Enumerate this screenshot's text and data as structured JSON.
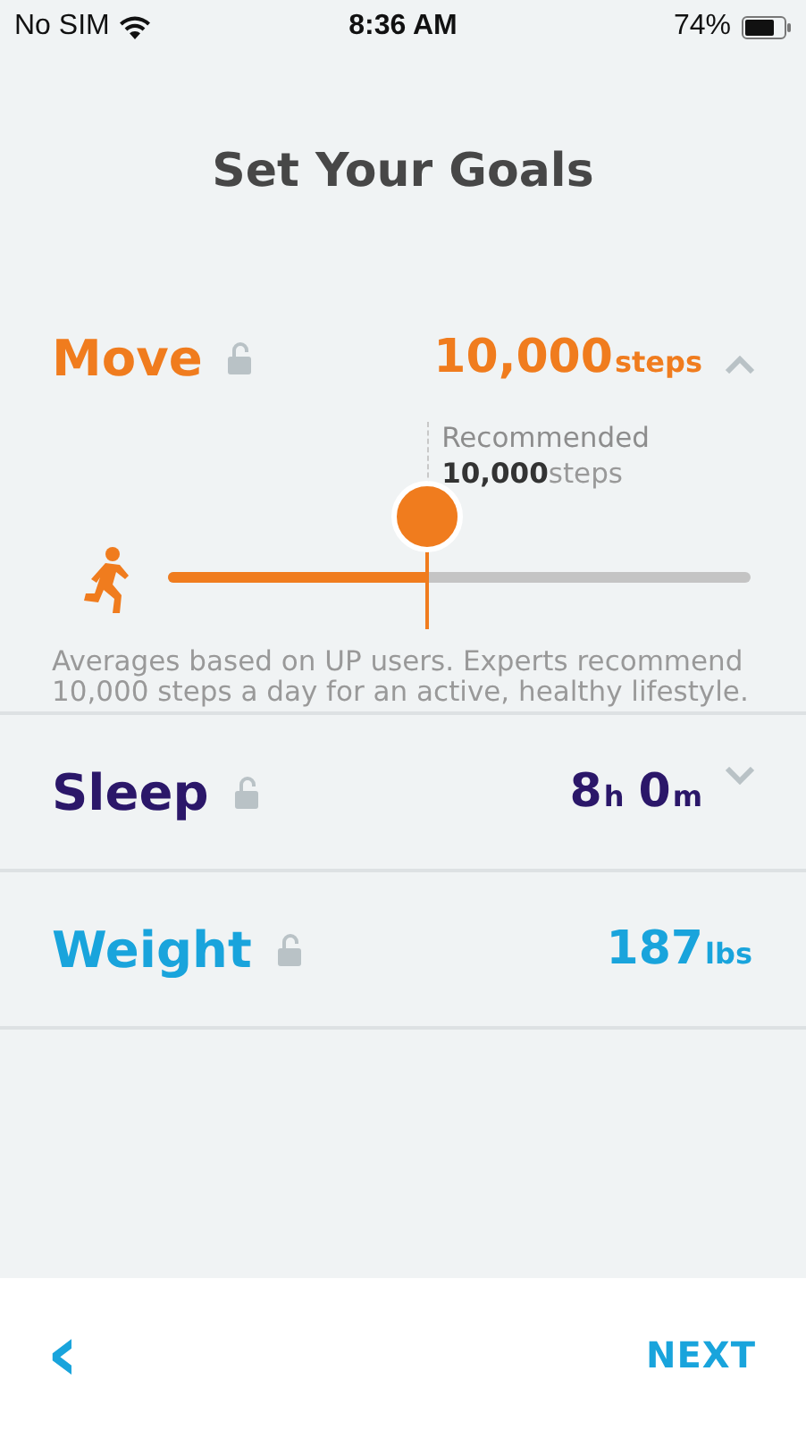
{
  "status_bar": {
    "carrier": "No SIM",
    "time": "8:36 AM",
    "battery": "74%"
  },
  "title": "Set Your Goals",
  "goals": [
    {
      "kind": "slider",
      "name": "Move",
      "color": "#f07c1e",
      "expanded": true,
      "value": [
        {
          "text": "10,000",
          "kind": "number"
        },
        {
          "text": "steps",
          "kind": "unit"
        }
      ],
      "slider": {
        "level": 0.445,
        "recommended_label": "Recommended",
        "recommended_value": [
          {
            "text": "10,000",
            "kind": "number"
          },
          {
            "text": "steps",
            "kind": "unit"
          }
        ]
      },
      "note": "Averages based on UP users. Experts recommend 10,000 steps a day for an active, healthy lifestyle."
    },
    {
      "kind": "plain",
      "name": "Sleep",
      "color": "#2b1769",
      "expanded": false,
      "value": [
        {
          "text": "8",
          "kind": "number"
        },
        {
          "text": "h",
          "kind": "unit"
        },
        {
          "text": "0",
          "kind": "number"
        },
        {
          "text": "m",
          "kind": "unit"
        }
      ]
    },
    {
      "kind": "plain",
      "name": "Weight",
      "color": "#19a4dc",
      "value": [
        {
          "text": "187",
          "kind": "number"
        },
        {
          "text": "lbs",
          "kind": "unit"
        }
      ]
    }
  ],
  "footer": {
    "back": "‹",
    "next": "NEXT"
  }
}
